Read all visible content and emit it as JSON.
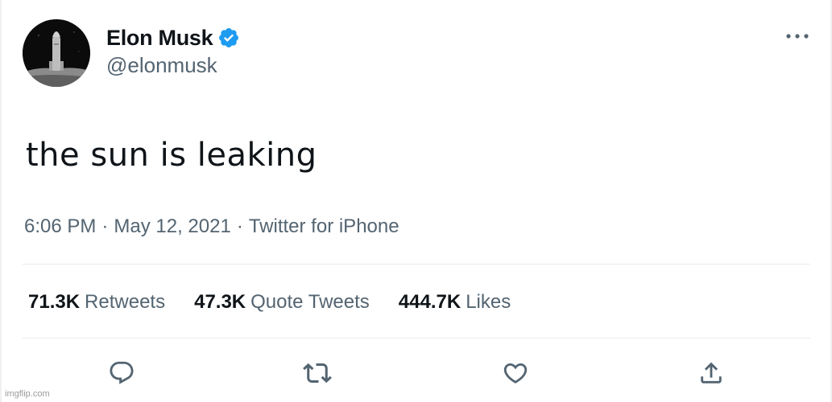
{
  "author": {
    "display_name": "Elon Musk",
    "handle": "@elonmusk",
    "verified": true,
    "avatar_icon": "rocket-avatar"
  },
  "tweet": {
    "text": "the sun is leaking",
    "time": "6:06 PM",
    "date": "May 12, 2021",
    "source": "Twitter for iPhone",
    "separator": "·"
  },
  "stats": {
    "retweets": {
      "count": "71.3K",
      "label": "Retweets"
    },
    "quote_tweets": {
      "count": "47.3K",
      "label": "Quote Tweets"
    },
    "likes": {
      "count": "444.7K",
      "label": "Likes"
    }
  },
  "actions": [
    {
      "name": "reply",
      "icon": "reply-icon"
    },
    {
      "name": "retweet",
      "icon": "retweet-icon"
    },
    {
      "name": "like",
      "icon": "heart-icon"
    },
    {
      "name": "share",
      "icon": "share-icon"
    }
  ],
  "watermark": "imgflip.com",
  "colors": {
    "text_primary": "#0f1419",
    "text_secondary": "#536471",
    "verified": "#1d9bf0",
    "divider": "#e6ecf0"
  }
}
